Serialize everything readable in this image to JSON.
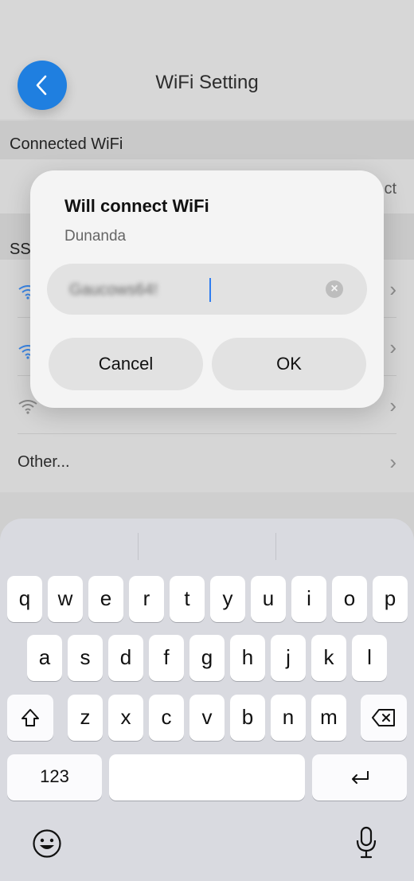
{
  "header": {
    "title": "WiFi Setting"
  },
  "sections": {
    "connected_header": "Connected WiFi",
    "connected_action": "ct",
    "ssid_header": "SS"
  },
  "list": {
    "other_label": "Other..."
  },
  "dialog": {
    "title": "Will connect WiFi",
    "network": "Dunanda",
    "password_value": "Gaucows64!",
    "cancel_label": "Cancel",
    "ok_label": "OK"
  },
  "keyboard": {
    "row1": [
      "q",
      "w",
      "e",
      "r",
      "t",
      "y",
      "u",
      "i",
      "o",
      "p"
    ],
    "row2": [
      "a",
      "s",
      "d",
      "f",
      "g",
      "h",
      "j",
      "k",
      "l"
    ],
    "row3": [
      "z",
      "x",
      "c",
      "v",
      "b",
      "n",
      "m"
    ],
    "numbers_label": "123"
  },
  "colors": {
    "accent": "#1f7fe0",
    "caret": "#2e7df0"
  }
}
